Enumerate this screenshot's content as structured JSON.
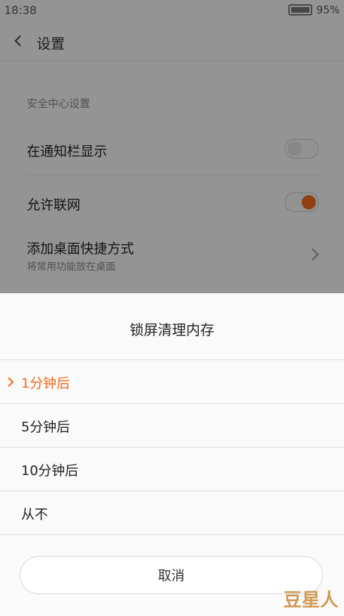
{
  "status_bar": {
    "time": "18:38",
    "battery": "95%"
  },
  "header": {
    "title": "设置"
  },
  "settings": {
    "section_label": "安全中心设置",
    "items": [
      {
        "label": "在通知栏显示",
        "toggle": "off"
      },
      {
        "label": "允许联网",
        "toggle": "on"
      },
      {
        "label": "添加桌面快捷方式",
        "sublabel": "将常用功能放在桌面"
      }
    ]
  },
  "dialog": {
    "title": "锁屏清理内存",
    "options": [
      {
        "label": "1分钟后",
        "selected": true
      },
      {
        "label": "5分钟后",
        "selected": false
      },
      {
        "label": "10分钟后",
        "selected": false
      },
      {
        "label": "从不",
        "selected": false
      }
    ],
    "cancel_label": "取消"
  },
  "watermark": "豆星人",
  "colors": {
    "accent": "#f26a1b",
    "overlay": "rgba(0,0,0,0.40)"
  },
  "icons": [
    "back-icon",
    "battery-icon",
    "chevron-right-icon",
    "selected-chevron-icon"
  ]
}
